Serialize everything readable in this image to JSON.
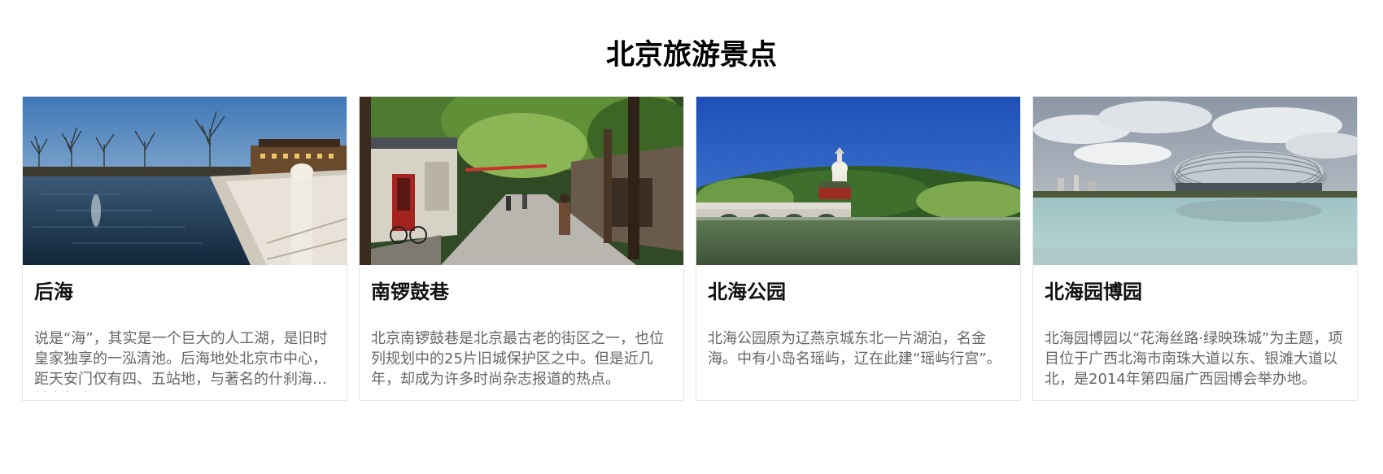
{
  "page": {
    "title": "北京旅游景点"
  },
  "cards": [
    {
      "title": "后海",
      "description": "说是“海”，其实是一个巨大的人工湖，是旧时皇家独享的一泓清池。后海地处北京市中心，距天安门仅有四、五站地，与著名的什刹海、前海相连。",
      "image": "houhai-lake-photo"
    },
    {
      "title": "南锣鼓巷",
      "description": "北京南锣鼓巷是北京最古老的街区之一，也位列规划中的25片旧城保护区之中。但是近几年，却成为许多时尚杂志报道的热点。",
      "image": "nanluoguxiang-street-photo"
    },
    {
      "title": "北海公园",
      "description": "北海公园原为辽燕京城东北一片湖泊，名金海。中有小岛名瑶屿，辽在此建“瑶屿行宫”。",
      "image": "beihai-park-photo"
    },
    {
      "title": "北海园博园",
      "description": "北海园博园以“花海丝路·绿映珠城”为主题，项目位于广西北海市南珠大道以东、银滩大道以北，是2014年第四届广西园博会举办地。",
      "image": "beihai-expo-garden-photo"
    }
  ],
  "colors": {
    "text_primary": "#111111",
    "text_secondary": "#666666",
    "card_border": "#e6e6e6",
    "background": "#ffffff"
  }
}
